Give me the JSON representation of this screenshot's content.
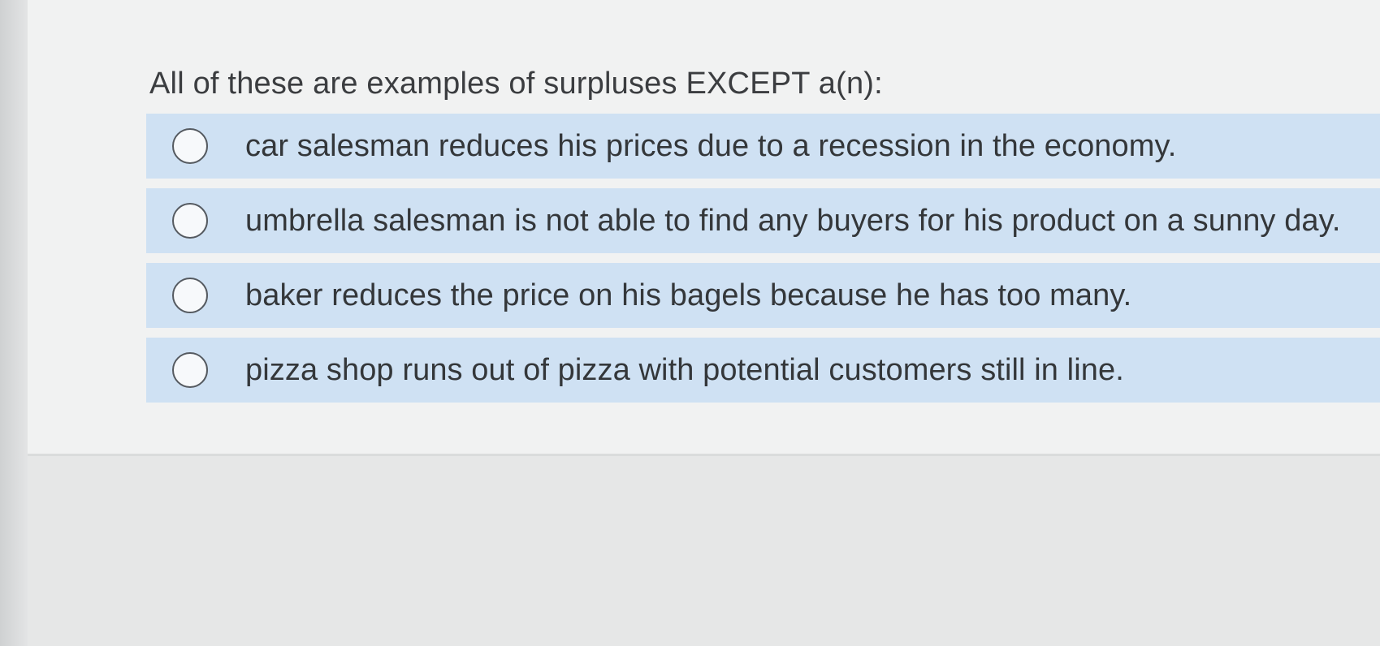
{
  "quiz": {
    "question": "All of these are examples of surpluses EXCEPT a(n):",
    "options": [
      {
        "label": "car salesman reduces his prices due to a recession in the economy.",
        "selected": false
      },
      {
        "label": "umbrella salesman is not able to find any buyers for his product on a sunny day.",
        "selected": false
      },
      {
        "label": "baker reduces the price on his bagels because he has too many.",
        "selected": false
      },
      {
        "label": "pizza shop runs out of pizza with potential customers still in line.",
        "selected": false
      }
    ]
  },
  "colors": {
    "option_background": "#cfe1f3",
    "card_background": "#f1f2f2",
    "text": "#34373a"
  }
}
